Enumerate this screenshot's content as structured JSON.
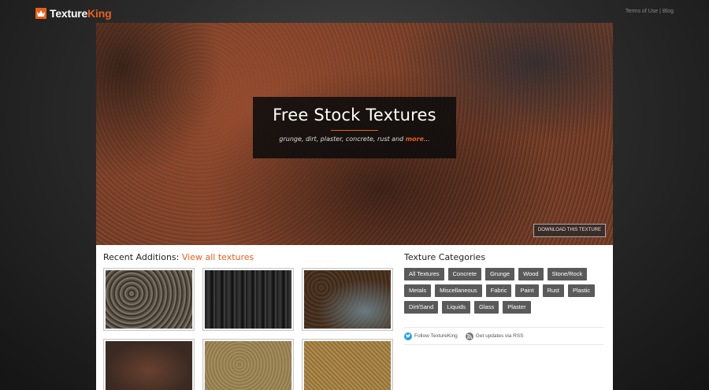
{
  "header": {
    "logo_part1": "Texture",
    "logo_part2": "King",
    "links": [
      "Terms of Use",
      "Blog"
    ],
    "link_separator": "|"
  },
  "hero": {
    "title": "Free Stock Textures",
    "subtitle_text": "grunge, dirt, plaster, concrete, rust and ",
    "subtitle_link": "more",
    "subtitle_end": "...",
    "download_label": "DOWNLOAD THIS TEXTURE"
  },
  "recent": {
    "title": "Recent Additions:",
    "link": "View all textures",
    "thumbnails": [
      {
        "name": "rubble-dirt-texture"
      },
      {
        "name": "charred-wood-texture"
      },
      {
        "name": "rusty-metal-texture"
      },
      {
        "name": "rusted-plate-texture"
      },
      {
        "name": "sand-dirt-texture"
      },
      {
        "name": "woven-fabric-texture"
      }
    ]
  },
  "categories": {
    "title": "Texture Categories",
    "items": [
      "All Textures",
      "Concrete",
      "Grunge",
      "Wood",
      "Stone/Rock",
      "Metals",
      "Miscellaneous",
      "Fabric",
      "Paint",
      "Rust",
      "Plastic",
      "Dirt/Sand",
      "Liquids",
      "Glass",
      "Plaster"
    ]
  },
  "social": {
    "twitter": "Follow TextureKing",
    "rss": "Get updates via RSS"
  },
  "colors": {
    "accent": "#e8601c",
    "category_bg": "#5a5a5a",
    "twitter": "#2aa3e0",
    "rss": "#7a7a7a"
  }
}
